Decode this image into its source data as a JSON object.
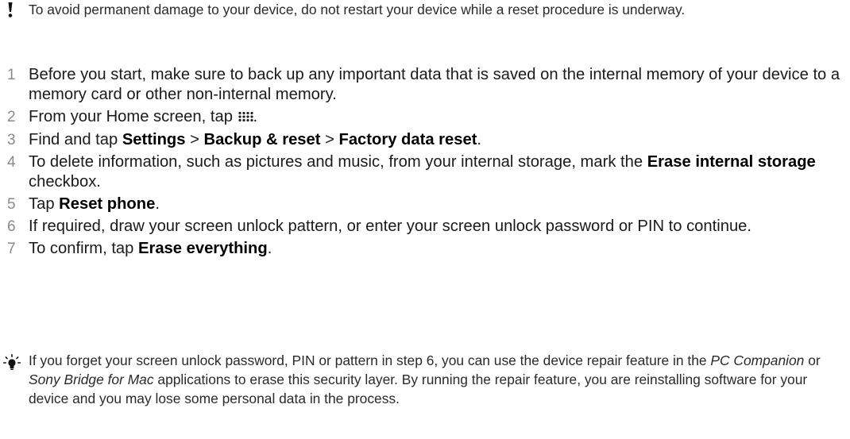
{
  "warning": {
    "icon": "exclamation-icon",
    "text": "To avoid permanent damage to your device, do not restart your device while a reset procedure is underway."
  },
  "steps": [
    {
      "num": "1",
      "text": "Before you start, make sure to back up any important data that is saved on the internal memory of your device to a memory card or other non-internal memory."
    },
    {
      "num": "2",
      "before": "From your Home screen, tap ",
      "icon": "app-grid-icon",
      "after": "."
    },
    {
      "num": "3",
      "t1": "Find and tap ",
      "b1": "Settings",
      "t2": " > ",
      "b2": "Backup & reset",
      "t3": " > ",
      "b3": "Factory data reset",
      "t4": "."
    },
    {
      "num": "4",
      "t1": "To delete information, such as pictures and music, from your internal storage, mark the ",
      "b1": "Erase internal storage",
      "t2": " checkbox."
    },
    {
      "num": "5",
      "t1": "Tap ",
      "b1": "Reset phone",
      "t2": "."
    },
    {
      "num": "6",
      "text": "If required, draw your screen unlock pattern, or enter your screen unlock password or PIN to continue."
    },
    {
      "num": "7",
      "t1": "To confirm, tap ",
      "b1": "Erase everything",
      "t2": "."
    }
  ],
  "tip": {
    "icon": "lightbulb-icon",
    "t1": "If you forget your screen unlock password, PIN or pattern in step 6, you can use the device repair feature in the ",
    "i1": "PC Companion",
    "t2": " or ",
    "i2": "Sony Bridge for Mac",
    "t3": " applications to erase this security layer. By running the repair feature, you are reinstalling software for your device and you may lose some personal data in the process."
  }
}
